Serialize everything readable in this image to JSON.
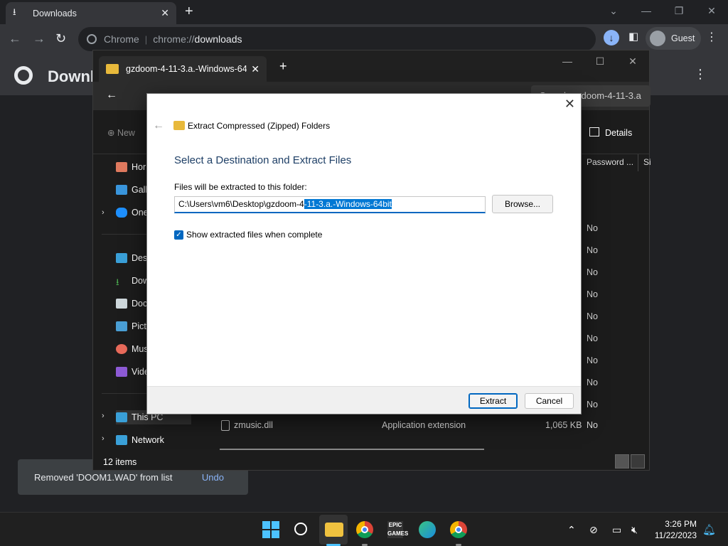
{
  "chrome": {
    "tab_title": "Downloads",
    "address_scheme": "Chrome",
    "address_host": "chrome://",
    "address_path": "downloads",
    "profile_label": "Guest",
    "page_title": "Downl",
    "toast_message": "Removed 'DOOM1.WAD' from list",
    "toast_undo": "Undo"
  },
  "explorer": {
    "tab_title": "gzdoom-4-11-3.a.-Windows-64",
    "search_placeholder": "Search gzdoom-4-11-3.a",
    "new_label": "New",
    "details_label": "Details",
    "nav_items": [
      "Hor",
      "Gall",
      "One",
      "Desk",
      "Dow",
      "Doc",
      "Pict",
      "Mus",
      "Vide",
      "This PC",
      "Network"
    ],
    "columns": {
      "password": "Password ...",
      "size": "Si"
    },
    "password_values": [
      "No",
      "No",
      "No",
      "No",
      "No",
      "No",
      "No",
      "No",
      "No",
      "No"
    ],
    "file_row": {
      "name": "zmusic.dll",
      "type": "Application extension",
      "size": "1,065 KB",
      "password": "No"
    },
    "status_count": "12 items"
  },
  "dialog": {
    "caption": "Extract Compressed (Zipped) Folders",
    "heading": "Select a Destination and Extract Files",
    "field_label": "Files will be extracted to this folder:",
    "path_unselected": "C:\\Users\\vm6\\Desktop\\gzdoom-4",
    "path_selected": "-11-3.a.-Windows-64bit",
    "browse_label": "Browse...",
    "checkbox_label": "Show extracted files when complete",
    "checkbox_checked": true,
    "extract_label": "Extract",
    "cancel_label": "Cancel"
  },
  "taskbar": {
    "time": "3:26 PM",
    "date": "11/22/2023",
    "epic_label": "EPIC GAMES"
  }
}
